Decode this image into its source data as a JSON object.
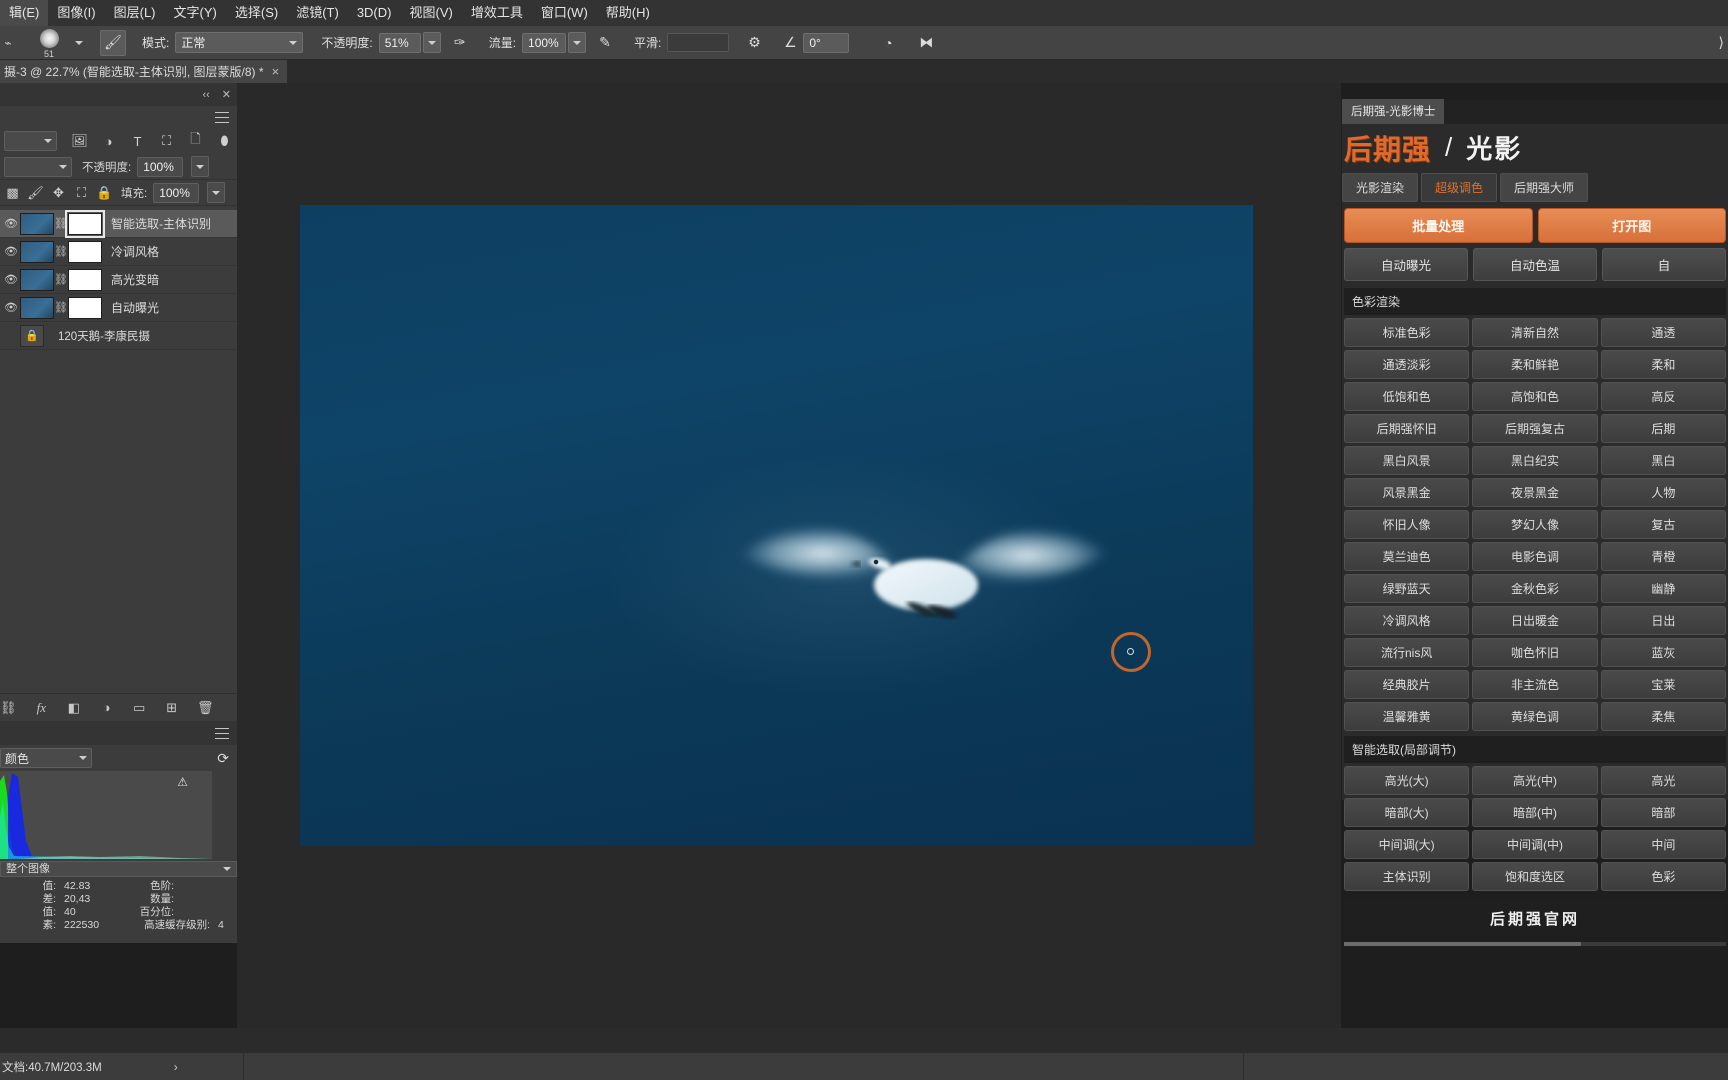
{
  "menubar": {
    "items": [
      {
        "label": "辑(E)",
        "name": "menu-edit"
      },
      {
        "label": "图像(I)",
        "name": "menu-image"
      },
      {
        "label": "图层(L)",
        "name": "menu-layer"
      },
      {
        "label": "文字(Y)",
        "name": "menu-type"
      },
      {
        "label": "选择(S)",
        "name": "menu-select"
      },
      {
        "label": "滤镜(T)",
        "name": "menu-filter"
      },
      {
        "label": "3D(D)",
        "name": "menu-3d"
      },
      {
        "label": "视图(V)",
        "name": "menu-view"
      },
      {
        "label": "增效工具",
        "name": "menu-plugins"
      },
      {
        "label": "窗口(W)",
        "name": "menu-window"
      },
      {
        "label": "帮助(H)",
        "name": "menu-help"
      }
    ]
  },
  "options_bar": {
    "brush_size": "51",
    "mode_label": "模式:",
    "mode_value": "正常",
    "opacity_label": "不透明度:",
    "opacity_value": "51%",
    "flow_label": "流量:",
    "flow_value": "100%",
    "smooth_label": "平滑:",
    "smooth_value": "",
    "angle_value": "0°"
  },
  "document_tab": {
    "title": "摄-3 @ 22.7% (智能选取-主体识别, 图层蒙版/8) *",
    "close": "×"
  },
  "layers_panel": {
    "collapse": "‹‹",
    "close": "✕",
    "blend_mode_value": "",
    "opacity_label": "不透明度:",
    "opacity_value": "100%",
    "fill_label": "填充:",
    "fill_value": "100%",
    "layers": [
      {
        "name": "智能选取-主体识别",
        "selected": true,
        "has_mask": true,
        "mask_active": true,
        "locked": false
      },
      {
        "name": "冷调风格",
        "selected": false,
        "has_mask": true,
        "mask_active": false,
        "locked": false
      },
      {
        "name": "高光变暗",
        "selected": false,
        "has_mask": true,
        "mask_active": false,
        "locked": false
      },
      {
        "name": "自动曝光",
        "selected": false,
        "has_mask": true,
        "mask_active": false,
        "locked": false
      },
      {
        "name": "120天鹅-李康民摄",
        "selected": false,
        "has_mask": false,
        "mask_active": false,
        "locked": true
      }
    ],
    "bottom_icons": [
      {
        "glyph": "⛓",
        "name": "link-layers-icon"
      },
      {
        "glyph": "fx",
        "name": "layer-style-icon"
      },
      {
        "glyph": "◧",
        "name": "add-mask-icon"
      },
      {
        "glyph": "◑",
        "name": "adjustment-layer-icon"
      },
      {
        "glyph": "▭",
        "name": "new-group-icon"
      },
      {
        "glyph": "⊞",
        "name": "new-layer-icon"
      },
      {
        "glyph": "🗑",
        "name": "delete-layer-icon"
      }
    ]
  },
  "histogram_panel": {
    "channel_value": "颜色",
    "refresh_icon": "⟳",
    "warning_icon": "⚠",
    "source_value": "整个图像",
    "stats": [
      {
        "key": "值:",
        "value": "42.83",
        "key2": "色阶:",
        "value2": ""
      },
      {
        "key": "差:",
        "value": "20,43",
        "key2": "数量:",
        "value2": ""
      },
      {
        "key": "值:",
        "value": "40",
        "key2": "百分位:",
        "value2": ""
      },
      {
        "key": "素:",
        "value": "222530",
        "key2": "高速缓存级别:",
        "value2": "4"
      }
    ]
  },
  "plugin_panel": {
    "tab_label": "后期强-光影博士",
    "logo_mark": "后期强",
    "logo_slash": "/",
    "logo_sub": "光影",
    "subtabs": [
      {
        "label": "光影渲染",
        "active": false
      },
      {
        "label": "超级调色",
        "active": true
      },
      {
        "label": "后期强大师",
        "active": false
      }
    ],
    "big_buttons": [
      {
        "label": "批量处理"
      },
      {
        "label": "打开图"
      }
    ],
    "auto_buttons": [
      {
        "label": "自动曝光"
      },
      {
        "label": "自动色温"
      },
      {
        "label": "自"
      }
    ],
    "sections": [
      {
        "title": "色彩渲染",
        "buttons": [
          "标准色彩",
          "清新自然",
          "通透",
          "通透淡彩",
          "柔和鲜艳",
          "柔和",
          "低饱和色",
          "高饱和色",
          "高反",
          "后期强怀旧",
          "后期强复古",
          "后期",
          "黑白风景",
          "黑白纪实",
          "黑白",
          "风景黑金",
          "夜景黑金",
          "人物",
          "怀旧人像",
          "梦幻人像",
          "复古",
          "莫兰迪色",
          "电影色调",
          "青橙",
          "绿野蓝天",
          "金秋色彩",
          "幽静",
          "冷调风格",
          "日出暖金",
          "日出",
          "流行nis风",
          "咖色怀旧",
          "蓝灰",
          "经典胶片",
          "非主流色",
          "宝莱",
          "温馨雅黄",
          "黄绿色调",
          "柔焦"
        ]
      },
      {
        "title": "智能选取(局部调节)",
        "buttons": [
          "高光(大)",
          "高光(中)",
          "高光",
          "暗部(大)",
          "暗部(中)",
          "暗部",
          "中间调(大)",
          "中间调(中)",
          "中间",
          "主体识别",
          "饱和度选区",
          "色彩"
        ]
      }
    ],
    "footer_label": "后期强官网"
  },
  "status_bar": {
    "doc_label": "文档:40.7M/203.3M",
    "arrow": "›"
  },
  "colors": {
    "accent_orange": "#e0702f",
    "panel_bg": "#3c3c3c",
    "canvas_bg": "#292929",
    "plugin_bg": "#2b2b2b",
    "photo_blue": "#0e4468"
  }
}
